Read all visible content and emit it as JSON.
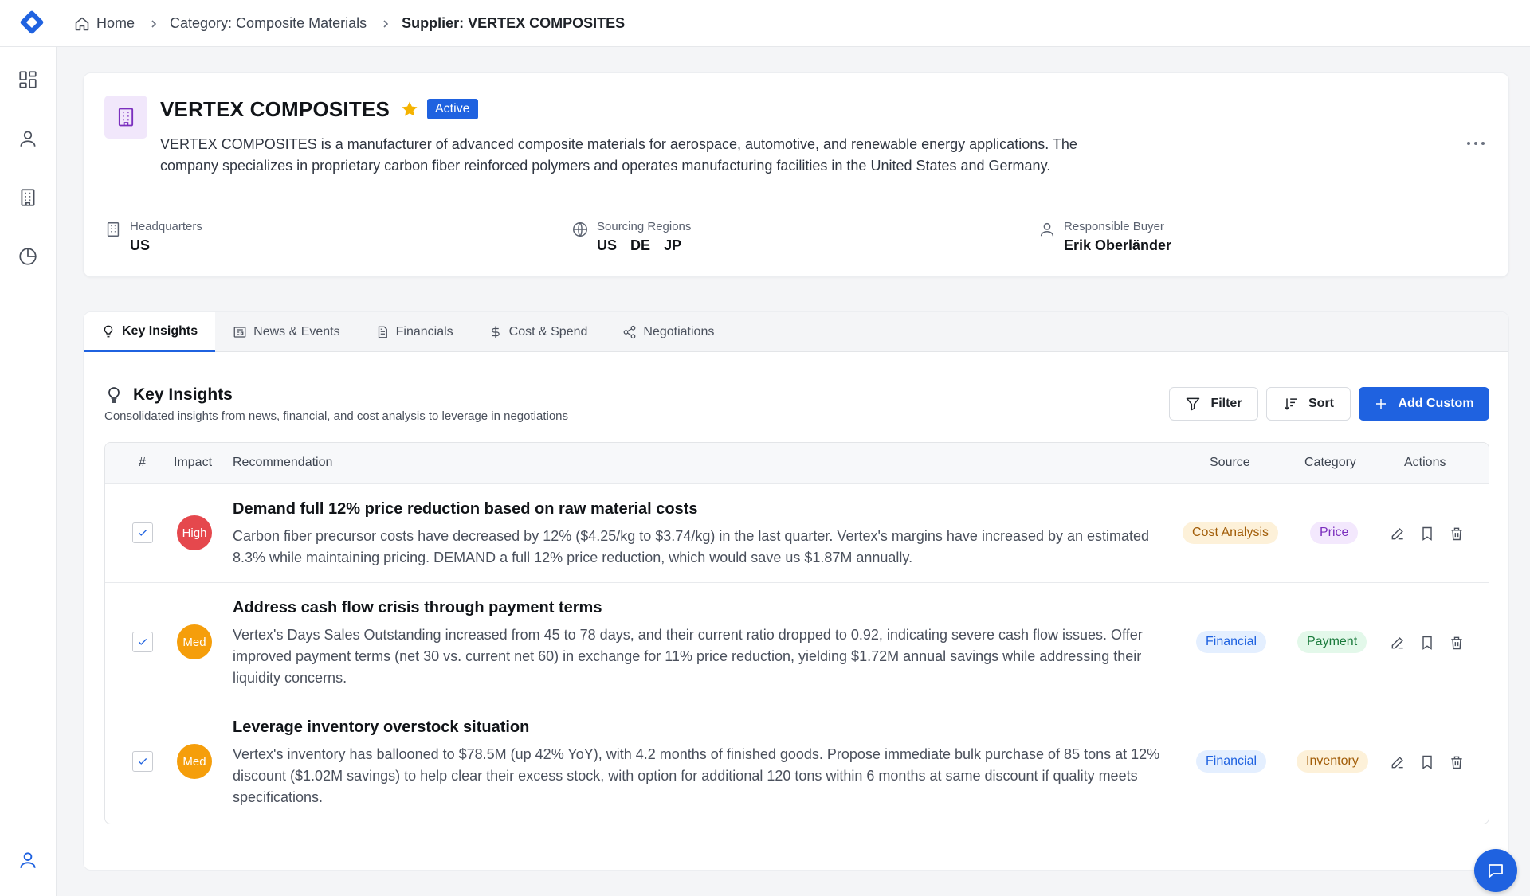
{
  "colors": {
    "accent": "#1f62e0",
    "high": "#e5484d",
    "med": "#f59e0b"
  },
  "breadcrumb": {
    "home": "Home",
    "category": "Category: Composite Materials",
    "supplier": "Supplier: VERTEX COMPOSITES"
  },
  "sidebar": {
    "icons": [
      "dashboard-icon",
      "user-icon",
      "building-icon",
      "pie-chart-icon",
      "profile-icon"
    ]
  },
  "supplier": {
    "name": "VERTEX COMPOSITES",
    "status": "Active",
    "description": "VERTEX COMPOSITES is a manufacturer of advanced composite materials for aerospace, automotive, and renewable energy applications. The company specializes in proprietary carbon fiber reinforced polymers and operates manufacturing facilities in the United States and Germany.",
    "headquarters_label": "Headquarters",
    "headquarters_value": "US",
    "regions_label": "Sourcing Regions",
    "regions": [
      "US",
      "DE",
      "JP"
    ],
    "buyer_label": "Responsible Buyer",
    "buyer_value": "Erik Oberländer"
  },
  "tabs": [
    {
      "label": "Key Insights",
      "icon": "lightbulb-icon"
    },
    {
      "label": "News & Events",
      "icon": "newspaper-icon"
    },
    {
      "label": "Financials",
      "icon": "document-icon"
    },
    {
      "label": "Cost & Spend",
      "icon": "dollar-icon"
    },
    {
      "label": "Negotiations",
      "icon": "share-icon"
    }
  ],
  "insights": {
    "title": "Key Insights",
    "subtitle": "Consolidated insights from news, financial, and cost analysis to leverage in negotiations",
    "filter_label": "Filter",
    "sort_label": "Sort",
    "add_label": "Add Custom",
    "columns": {
      "num": "#",
      "impact": "Impact",
      "recommendation": "Recommendation",
      "source": "Source",
      "category": "Category",
      "actions": "Actions"
    },
    "rows": [
      {
        "impact": "High",
        "title": "Demand full 12% price reduction based on raw material costs",
        "description": "Carbon fiber precursor costs have decreased by 12% ($4.25/kg to $3.74/kg) in the last quarter. Vertex's margins have increased by an estimated 8.3% while maintaining pricing. DEMAND a full 12% price reduction, which would save us $1.87M annually.",
        "source": "Cost Analysis",
        "category": "Price"
      },
      {
        "impact": "Med",
        "title": "Address cash flow crisis through payment terms",
        "description": "Vertex's Days Sales Outstanding increased from 45 to 78 days, and their current ratio dropped to 0.92, indicating severe cash flow issues. Offer improved payment terms (net 30 vs. current net 60) in exchange for 11% price reduction, yielding $1.72M annual savings while addressing their liquidity concerns.",
        "source": "Financial",
        "category": "Payment"
      },
      {
        "impact": "Med",
        "title": "Leverage inventory overstock situation",
        "description": "Vertex's inventory has ballooned to $78.5M (up 42% YoY), with 4.2 months of finished goods. Propose immediate bulk purchase of 85 tons at 12% discount ($1.02M savings) to help clear their excess stock, with option for additional 120 tons within 6 months at same discount if quality meets specifications.",
        "source": "Financial",
        "category": "Inventory"
      }
    ]
  }
}
